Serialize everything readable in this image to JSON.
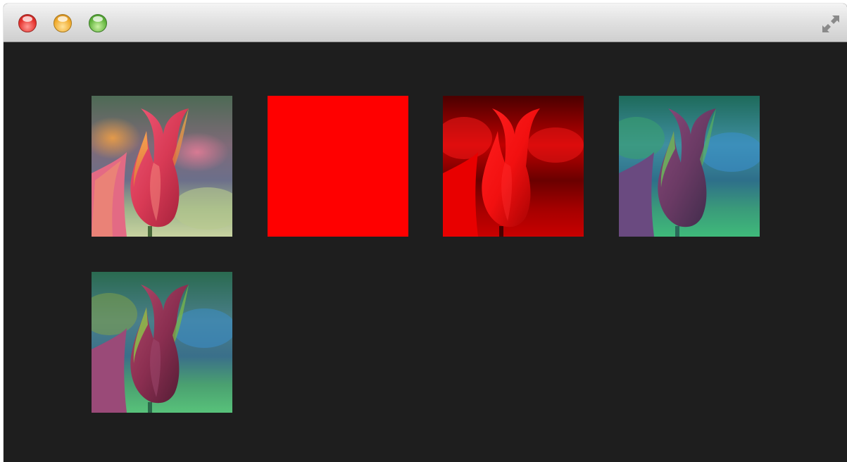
{
  "window": {
    "title": "",
    "background_color": "#1e1e1e"
  },
  "titlebar": {
    "buttons": [
      {
        "name": "close-button",
        "icon": "close-dot",
        "color": "#e5302b"
      },
      {
        "name": "minimize-button",
        "icon": "minimize-dot",
        "color": "#f0aa2c"
      },
      {
        "name": "zoom-button",
        "icon": "zoom-dot",
        "color": "#62b43d"
      }
    ],
    "fullscreen_icon": "fullscreen-arrows-icon"
  },
  "images": [
    {
      "name": "tulip-original",
      "filter": "original"
    },
    {
      "name": "tulip-red-fill",
      "filter": "solid-red",
      "color": "#ff0000"
    },
    {
      "name": "tulip-red-channel",
      "filter": "red-channel"
    },
    {
      "name": "tulip-teal-tint",
      "filter": "teal-tint"
    },
    {
      "name": "tulip-green-tint",
      "filter": "green-tint"
    }
  ]
}
